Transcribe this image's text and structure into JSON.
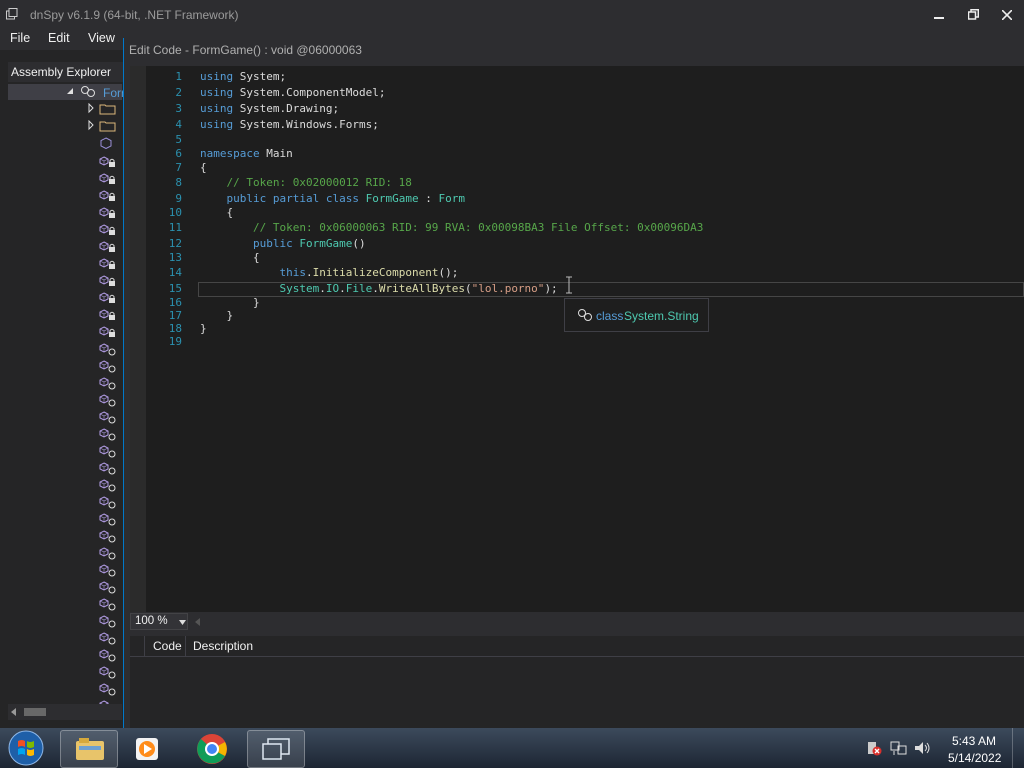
{
  "window": {
    "title": "dnSpy v6.1.9 (64-bit, .NET Framework)"
  },
  "menu": [
    "File",
    "Edit",
    "View"
  ],
  "explorer": {
    "tab_label": "Assembly Explorer",
    "selected_item": "Forr"
  },
  "dialog": {
    "title": "Edit Code - FormGame() : void @06000063",
    "zoom": "100 %",
    "error_columns": [
      "Code",
      "Description"
    ]
  },
  "code": {
    "line_numbers": [
      "1",
      "2",
      "3",
      "4",
      "5",
      "6",
      "7",
      "8",
      "9",
      "10",
      "11",
      "12",
      "13",
      "14",
      "15",
      "16",
      "17",
      "18",
      "19"
    ],
    "lines": [
      "using System;",
      "using System.ComponentModel;",
      "using System.Drawing;",
      "using System.Windows.Forms;",
      "",
      "namespace Main",
      "{",
      "    // Token: 0x02000012 RID: 18",
      "    public partial class FormGame : Form",
      "    {",
      "        // Token: 0x06000063 RID: 99 RVA: 0x00098BA3 File Offset: 0x00096DA3",
      "        public FormGame()",
      "        {",
      "            this.InitializeComponent();",
      "            System.IO.File.WriteAllBytes(\"lol.porno\");",
      "        }",
      "    }",
      "}",
      ""
    ]
  },
  "tooltip": {
    "keyword": "class",
    "type": "System.String"
  },
  "taskbar": {
    "time": "5:43 AM",
    "date": "5/14/2022"
  },
  "colors": {
    "accent": "#0079cc",
    "editor_bg": "#1e1e1e",
    "keyword": "#569cd6",
    "type": "#4ec9b0",
    "comment": "#57a64a",
    "string": "#d69d85",
    "line_number": "#2b91af"
  }
}
